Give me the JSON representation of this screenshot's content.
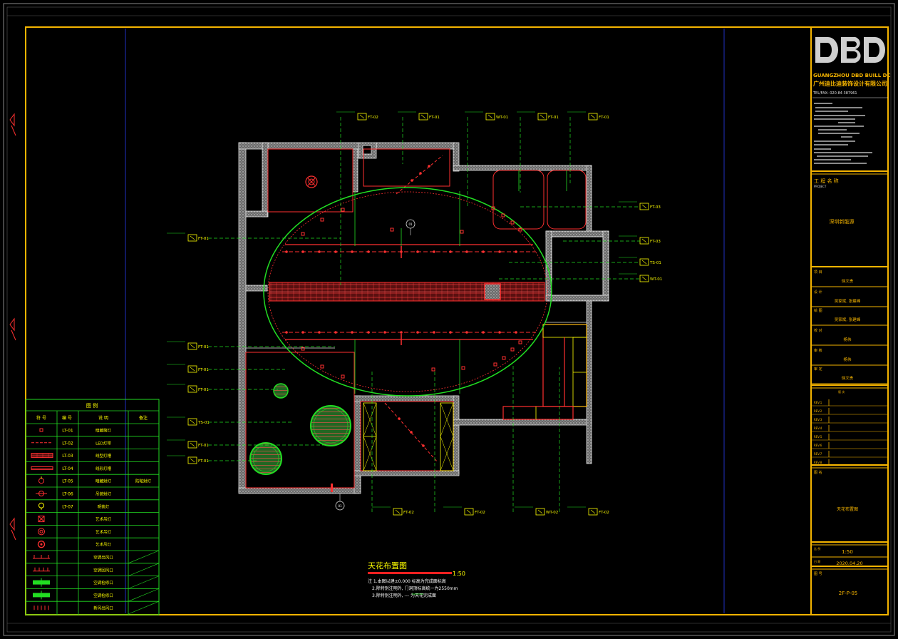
{
  "title_block": {
    "logo": "DBD",
    "company_en": "GUANGZHOU DBD BUILL DC",
    "company_cn": "广州迪比迪装饰设计有限公司",
    "tel": "TEL/FAX: 020-84 387961",
    "project_label": "工 程 名 称",
    "project_sub": "PROJECT",
    "project_name": "深圳新能源",
    "roles": [
      {
        "label": "项 目",
        "value": "徐文贵"
      },
      {
        "label": "设 计",
        "value": "吴家斌, 张建峰"
      },
      {
        "label": "绘 图",
        "value": "吴家斌, 张建峰"
      },
      {
        "label": "校 对",
        "value": "杨伟"
      },
      {
        "label": "审 核",
        "value": "杨伟"
      },
      {
        "label": "审 定",
        "value": "徐文贵"
      }
    ],
    "rev_label": "版 次",
    "revs": [
      "REV.1",
      "REV.2",
      "REV.3",
      "REV.4",
      "REV.5",
      "REV.6",
      "REV.7",
      "REV.8"
    ],
    "drawing_title_label": "图 名",
    "drawing_title": "天花布置图",
    "scale_label": "比 例",
    "scale": "1:50",
    "date_label": "日 期",
    "date": "2020.04.20",
    "number_label": "图 号",
    "number": "2F-P-05"
  },
  "legend": {
    "title": "图  例",
    "headers": [
      "符 号",
      "编 号",
      "说 明",
      "备注"
    ],
    "rows": [
      {
        "code": "LT-01",
        "desc": "暗藏筒灯",
        "note": ""
      },
      {
        "code": "LT-02",
        "desc": "LED灯带",
        "note": ""
      },
      {
        "code": "LT-03",
        "desc": "线型灯槽",
        "note": ""
      },
      {
        "code": "LT-04",
        "desc": "线形灯槽",
        "note": ""
      },
      {
        "code": "LT-05",
        "desc": "暗藏射灯",
        "note": "防眩射灯"
      },
      {
        "code": "LT-06",
        "desc": "吊装射灯",
        "note": ""
      },
      {
        "code": "LT-07",
        "desc": "明装灯",
        "note": ""
      },
      {
        "code": "",
        "desc": "艺术吊灯",
        "note": ""
      },
      {
        "code": "",
        "desc": "艺术吊灯",
        "note": ""
      },
      {
        "code": "",
        "desc": "艺术吊灯",
        "note": ""
      },
      {
        "code": "",
        "desc": "空调出风口",
        "note": ""
      },
      {
        "code": "",
        "desc": "空调回风口",
        "note": ""
      },
      {
        "code": "",
        "desc": "空调检修口",
        "note": ""
      },
      {
        "code": "",
        "desc": "空调检修口",
        "note": ""
      },
      {
        "code": "",
        "desc": "新风出风口",
        "note": ""
      }
    ]
  },
  "plan": {
    "title": "天花布置图",
    "scale": "1:50",
    "notes": [
      "注 1.本图以建±0.000 标高为完成面标高",
      "2.除特别注明外, 门洞顶标高统一为2550mm",
      "3.除特别注明外,              --- 为天花完成面"
    ],
    "tags_top": [
      "FT-02",
      "FT-01",
      "WT-01",
      "FT-01",
      "FT-01"
    ],
    "tags_left": [
      "FT-01",
      "FT-01",
      "FT-01",
      "FT-01",
      "TS-01",
      "FT-01",
      "FT-01",
      "FT-01"
    ],
    "tags_right": [
      "FT-03",
      "FT-03",
      "TS-01",
      "WT-01"
    ],
    "tags_bottom": [
      "FT-02",
      "FT-02",
      "WT-02",
      "FT-02"
    ],
    "markers": [
      "01",
      "01"
    ]
  },
  "colors": {
    "background": "#000000",
    "frame": "#f5b400",
    "wall": "#d8d8d8",
    "green": "#22dd22",
    "red": "#ff2020",
    "yellow": "#ffff00",
    "blue": "#2030c0",
    "white": "#ffffff"
  }
}
